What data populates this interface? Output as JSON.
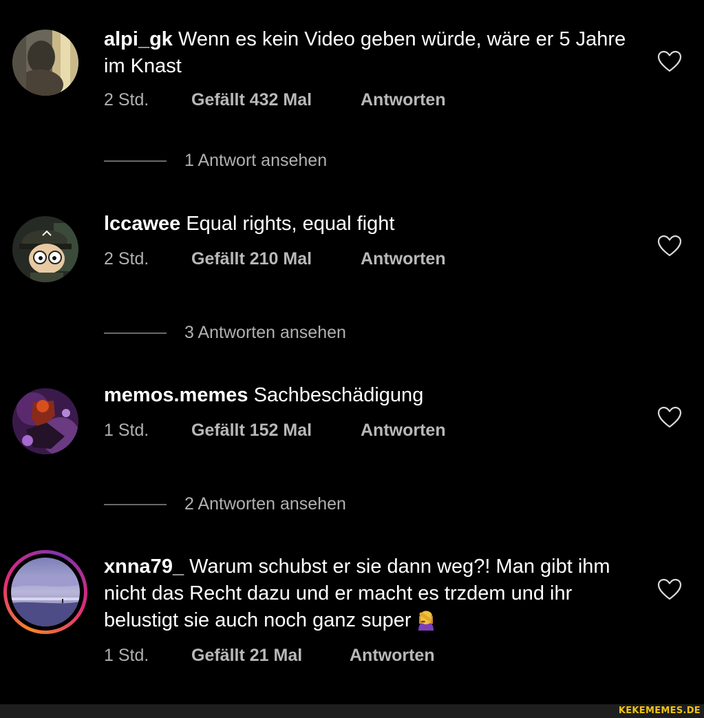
{
  "comments": [
    {
      "username": "alpi_gk",
      "text": " Wenn es kein Video geben würde, wäre er 5 Jahre im Knast",
      "time": "2 Std.",
      "likes": "Gefällt 432 Mal",
      "reply_label": "Antworten",
      "view_replies": "1 Antwort ansehen"
    },
    {
      "username": "lccawee",
      "text": " Equal rights, equal fight",
      "time": "2 Std.",
      "likes": "Gefällt 210 Mal",
      "reply_label": "Antworten",
      "view_replies": "3 Antworten ansehen"
    },
    {
      "username": "memos.memes",
      "text": " Sachbeschädigung",
      "time": "1 Std.",
      "likes": "Gefällt 152 Mal",
      "reply_label": "Antworten",
      "view_replies": "2 Antworten ansehen"
    },
    {
      "username": "xnna79_",
      "text": " Warum schubst er sie dann weg?! Man gibt ihm nicht das Recht dazu und er macht es trzdem und ihr belustigt sie auch noch ganz super",
      "emoji": "woman-facepalming-icon",
      "time": "1 Std.",
      "likes": "Gefällt 21 Mal",
      "reply_label": "Antworten",
      "has_story_ring": true
    }
  ],
  "watermark": "KEKEMEMES.DE",
  "colors": {
    "background": "#000000",
    "meta_text": "#b0b0b0",
    "watermark": "#f1c40f"
  }
}
